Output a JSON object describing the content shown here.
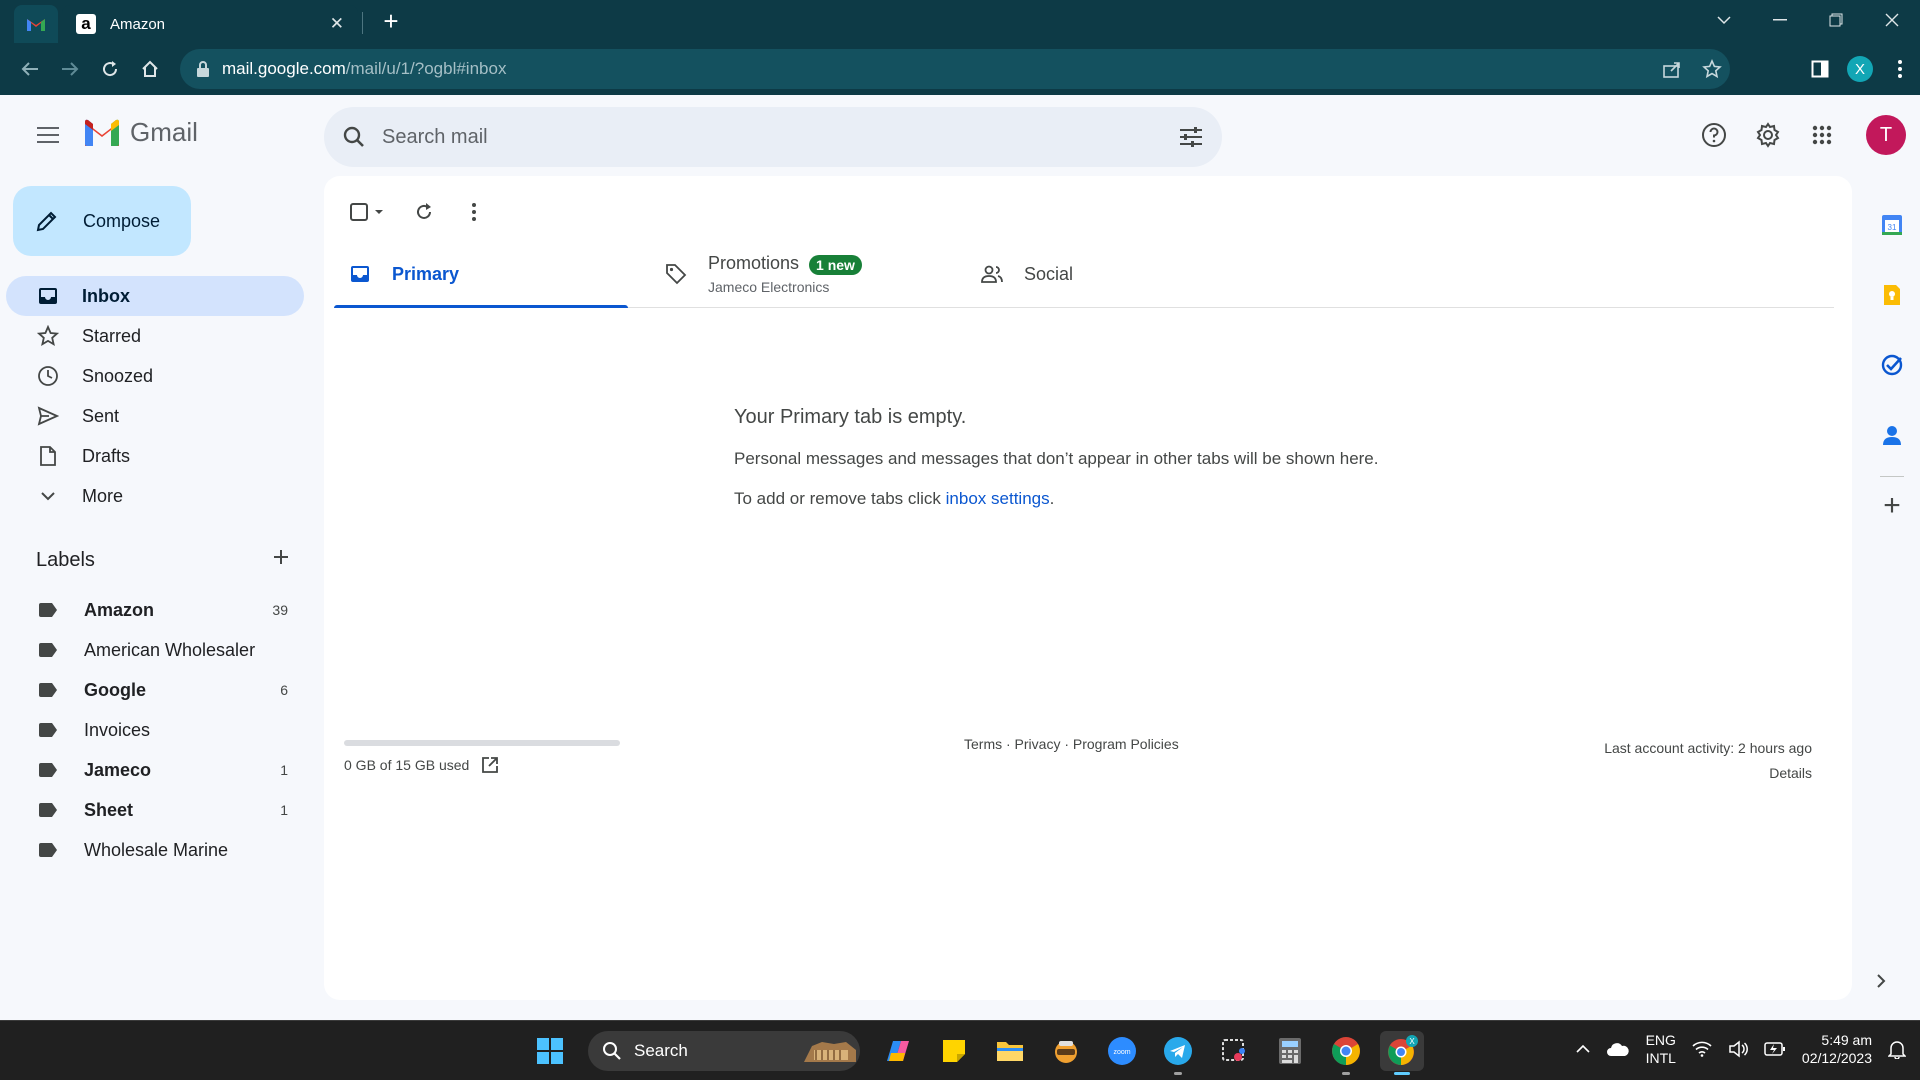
{
  "browser": {
    "tab_title": "Amazon",
    "url_host": "mail.google.com",
    "url_path": "/mail/u/1/?ogbl#inbox",
    "profile_initial": "X"
  },
  "header": {
    "app_name": "Gmail",
    "search_placeholder": "Search mail",
    "avatar_initial": "T"
  },
  "sidebar": {
    "compose_label": "Compose",
    "nav": [
      {
        "label": "Inbox",
        "icon": "inbox-icon"
      },
      {
        "label": "Starred",
        "icon": "star-icon"
      },
      {
        "label": "Snoozed",
        "icon": "clock-icon"
      },
      {
        "label": "Sent",
        "icon": "send-icon"
      },
      {
        "label": "Drafts",
        "icon": "draft-icon"
      },
      {
        "label": "More",
        "icon": "chevron-down-icon"
      }
    ],
    "labels_heading": "Labels",
    "labels": [
      {
        "name": "Amazon",
        "count": "39",
        "bold": true
      },
      {
        "name": "American Wholesaler",
        "count": "",
        "bold": false
      },
      {
        "name": "Google",
        "count": "6",
        "bold": true
      },
      {
        "name": "Invoices",
        "count": "",
        "bold": false
      },
      {
        "name": "Jameco",
        "count": "1",
        "bold": true
      },
      {
        "name": "Sheet",
        "count": "1",
        "bold": true
      },
      {
        "name": "Wholesale Marine",
        "count": "",
        "bold": false
      }
    ]
  },
  "main": {
    "tabs": {
      "primary": "Primary",
      "promotions": "Promotions",
      "promotions_badge": "1 new",
      "promotions_sub": "Jameco Electronics",
      "social": "Social"
    },
    "empty": {
      "title": "Your Primary tab is empty.",
      "line1": "Personal messages and messages that don’t appear in other tabs will be shown here.",
      "line2_prefix": "To add or remove tabs click ",
      "line2_link": "inbox settings",
      "line2_suffix": "."
    },
    "storage_text": "0 GB of 15 GB used",
    "storage_fraction": 0,
    "footer_links": "Terms · Privacy · Program Policies",
    "activity": "Last account activity: 2 hours ago",
    "details": "Details"
  },
  "taskbar": {
    "search_label": "Search",
    "lang_1": "ENG",
    "lang_2": "INTL",
    "time": "5:49 am",
    "date": "02/12/2023"
  },
  "colors": {
    "chrome_bg": "#0d3a46",
    "accent": "#0b57d0",
    "compose_bg": "#c2e7ff",
    "active_nav_bg": "#d3e3fd",
    "badge_green": "#188038",
    "avatar_bg": "#c2185b"
  }
}
